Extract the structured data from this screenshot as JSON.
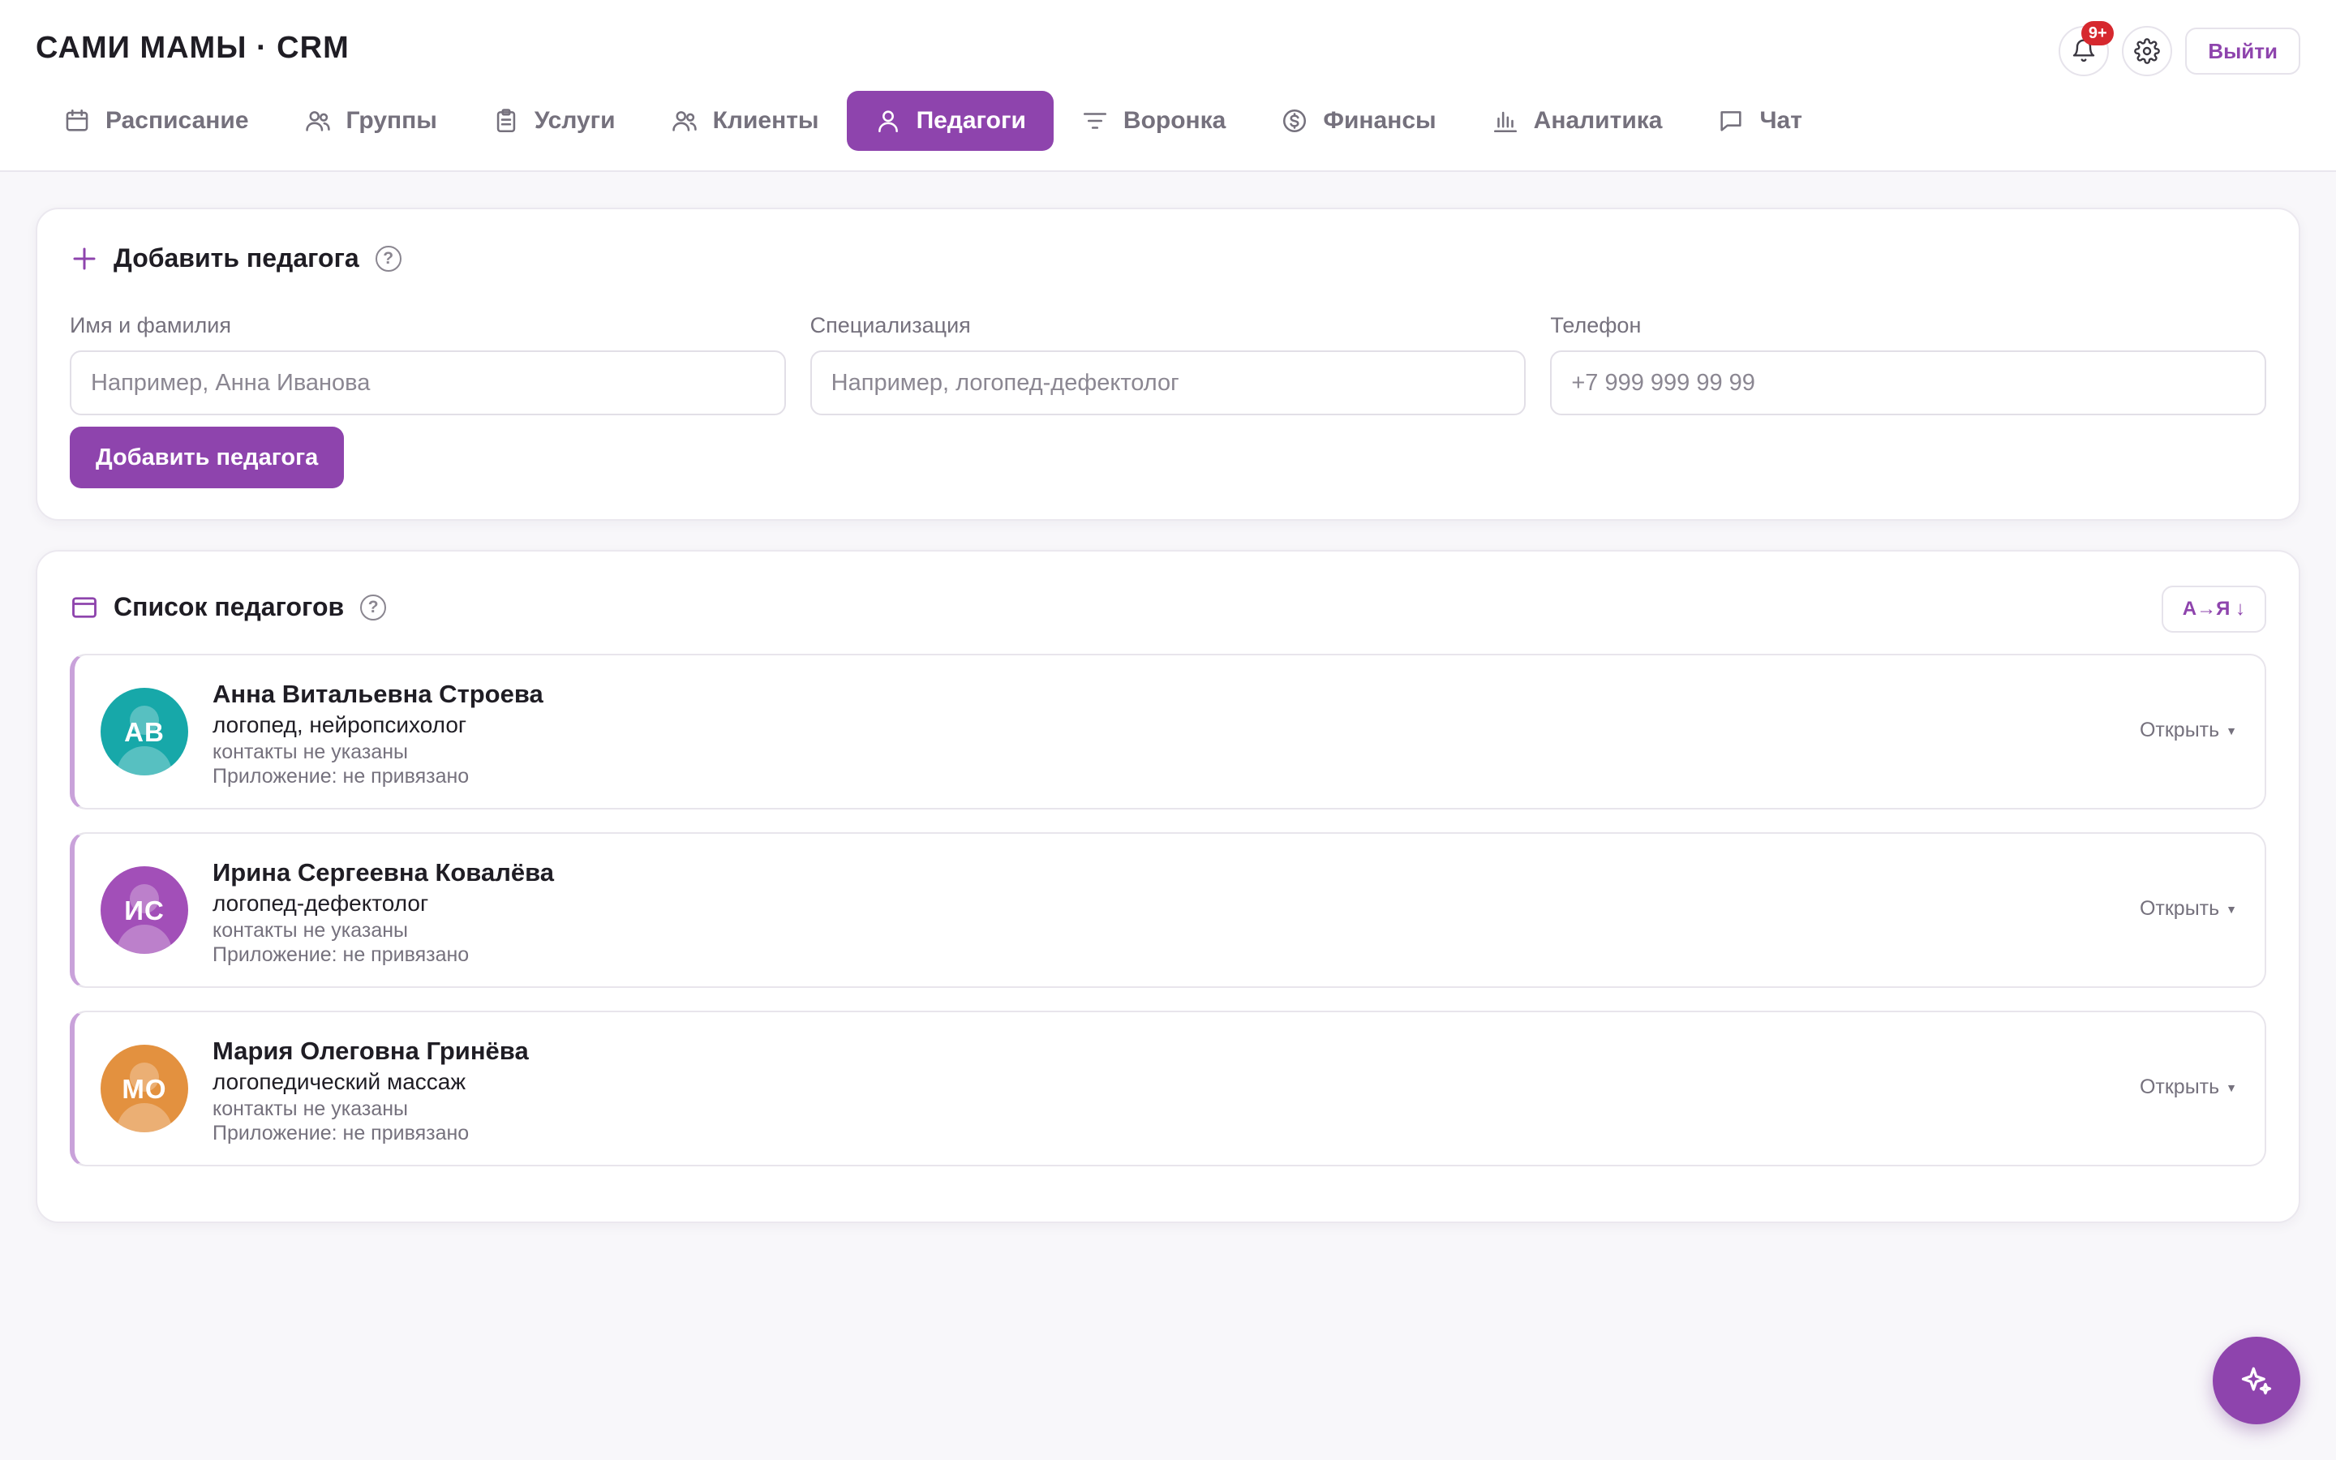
{
  "app": {
    "title": "САМИ МАМЫ · CRM"
  },
  "header": {
    "notifications_badge": "9+",
    "logout_label": "Выйти"
  },
  "nav": {
    "tabs": [
      {
        "label": "Расписание",
        "icon": "calendar-icon"
      },
      {
        "label": "Группы",
        "icon": "users-icon"
      },
      {
        "label": "Услуги",
        "icon": "clipboard-icon"
      },
      {
        "label": "Клиенты",
        "icon": "users-icon"
      },
      {
        "label": "Педагоги",
        "icon": "user-icon",
        "active": true
      },
      {
        "label": "Воронка",
        "icon": "filter-icon"
      },
      {
        "label": "Финансы",
        "icon": "dollar-icon"
      },
      {
        "label": "Аналитика",
        "icon": "bar-chart-icon"
      },
      {
        "label": "Чат",
        "icon": "chat-icon"
      }
    ]
  },
  "add_teacher": {
    "title": "Добавить педагога",
    "fields": {
      "name": {
        "label": "Имя и фамилия",
        "placeholder": "Например, Анна Иванова"
      },
      "specialization": {
        "label": "Специализация",
        "placeholder": "Например, логопед-дефектолог"
      },
      "phone": {
        "label": "Телефон",
        "placeholder": "+7 999 999 99 99"
      }
    },
    "submit_label": "Добавить педагога"
  },
  "teacher_list": {
    "title": "Список педагогов",
    "sort_label": "А→Я ↓",
    "open_label": "Открыть",
    "teachers": [
      {
        "initials": "АВ",
        "avatar_color": "#17a8a9",
        "name": "Анна Витальевна Строева",
        "specialization": "логопед, нейропсихолог",
        "contacts": "контакты не указаны",
        "app_status": "Приложение: не привязано"
      },
      {
        "initials": "ИС",
        "avatar_color": "#a24fb8",
        "name": "Ирина Сергеевна Ковалёва",
        "specialization": "логопед-дефектолог",
        "contacts": "контакты не указаны",
        "app_status": "Приложение: не привязано"
      },
      {
        "initials": "МО",
        "avatar_color": "#e3913f",
        "name": "Мария Олеговна Гринёва",
        "specialization": "логопедический массаж",
        "contacts": "контакты не указаны",
        "app_status": "Приложение: не привязано"
      }
    ]
  },
  "colors": {
    "accent": "#8e44ad",
    "badge": "#d6282e",
    "background": "#f8f7fa"
  }
}
